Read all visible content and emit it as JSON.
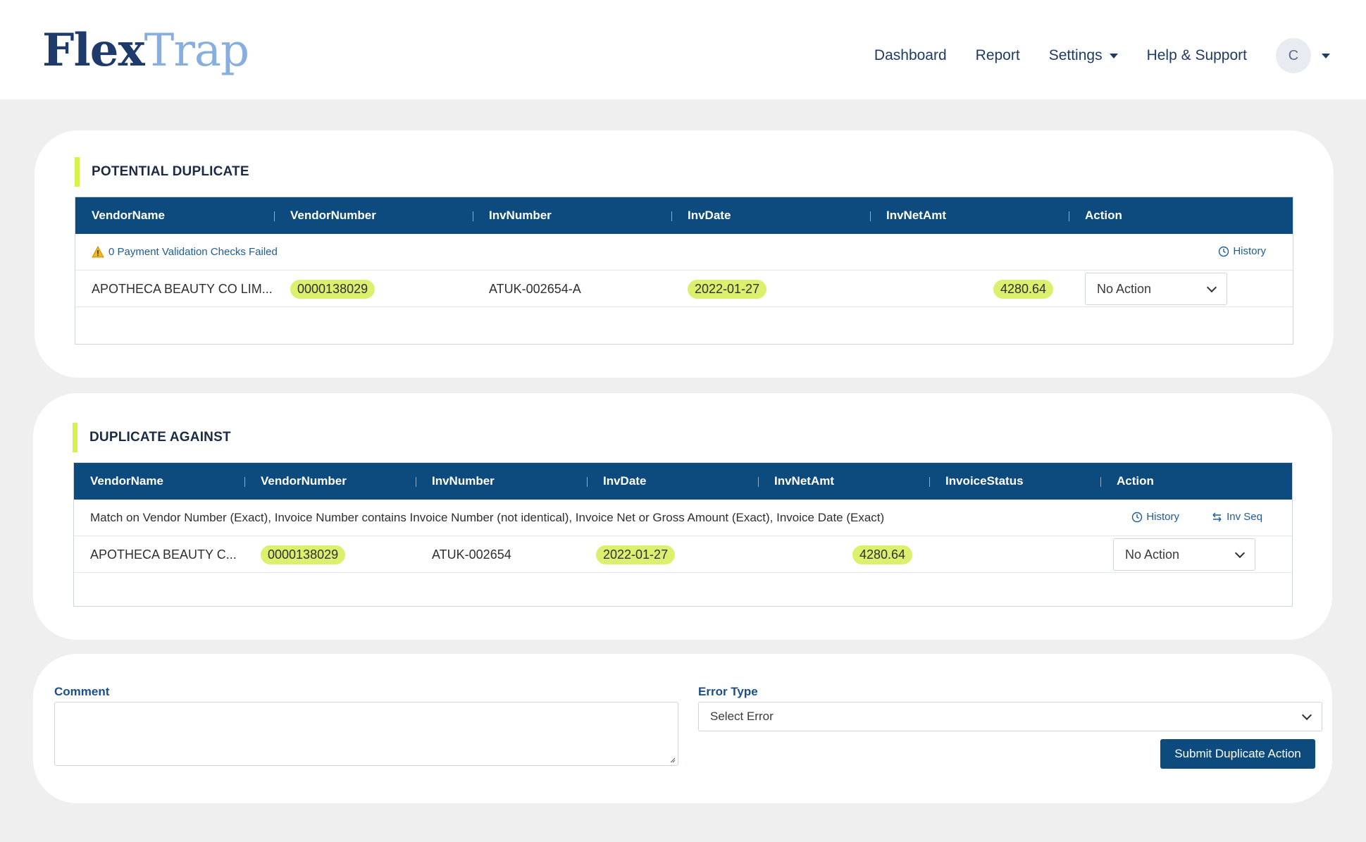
{
  "header": {
    "logo_part1": "Flex",
    "logo_part2": "Trap",
    "nav": {
      "dashboard": "Dashboard",
      "report": "Report",
      "settings": "Settings",
      "help": "Help & Support"
    },
    "avatar_initial": "C"
  },
  "potential_duplicate": {
    "title": "POTENTIAL DUPLICATE",
    "columns": [
      "VendorName",
      "VendorNumber",
      "InvNumber",
      "InvDate",
      "InvNetAmt",
      "Action"
    ],
    "info_text": "0 Payment Validation Checks Failed",
    "history_label": "History",
    "row": {
      "vendor_name": "APOTHECA BEAUTY CO LIM...",
      "vendor_number": "0000138029",
      "inv_number": "ATUK-002654-A",
      "inv_date": "2022-01-27",
      "inv_net_amt": "4280.64",
      "action": "No Action"
    }
  },
  "duplicate_against": {
    "title": "DUPLICATE AGAINST",
    "columns": [
      "VendorName",
      "VendorNumber",
      "InvNumber",
      "InvDate",
      "InvNetAmt",
      "InvoiceStatus",
      "Action"
    ],
    "match_text": "Match on Vendor Number (Exact), Invoice Number contains Invoice Number (not identical), Invoice Net or Gross Amount (Exact), Invoice Date (Exact)",
    "history_label": "History",
    "inv_seq_label": "Inv Seq",
    "row": {
      "vendor_name": "APOTHECA BEAUTY C...",
      "vendor_number": "0000138029",
      "inv_number": "ATUK-002654",
      "inv_date": "2022-01-27",
      "inv_net_amt": "4280.64",
      "invoice_status": "",
      "action": "No Action"
    }
  },
  "comment_form": {
    "comment_label": "Comment",
    "comment_value": "",
    "error_type_label": "Error Type",
    "error_type_value": "Select Error",
    "submit_label": "Submit Duplicate Action"
  },
  "colors": {
    "header_blue": "#0d4a7e",
    "highlight": "#dcf06e",
    "accent_bar": "#d9f04a",
    "logo_dark": "#1d3a6b",
    "logo_light": "#86aee0"
  }
}
